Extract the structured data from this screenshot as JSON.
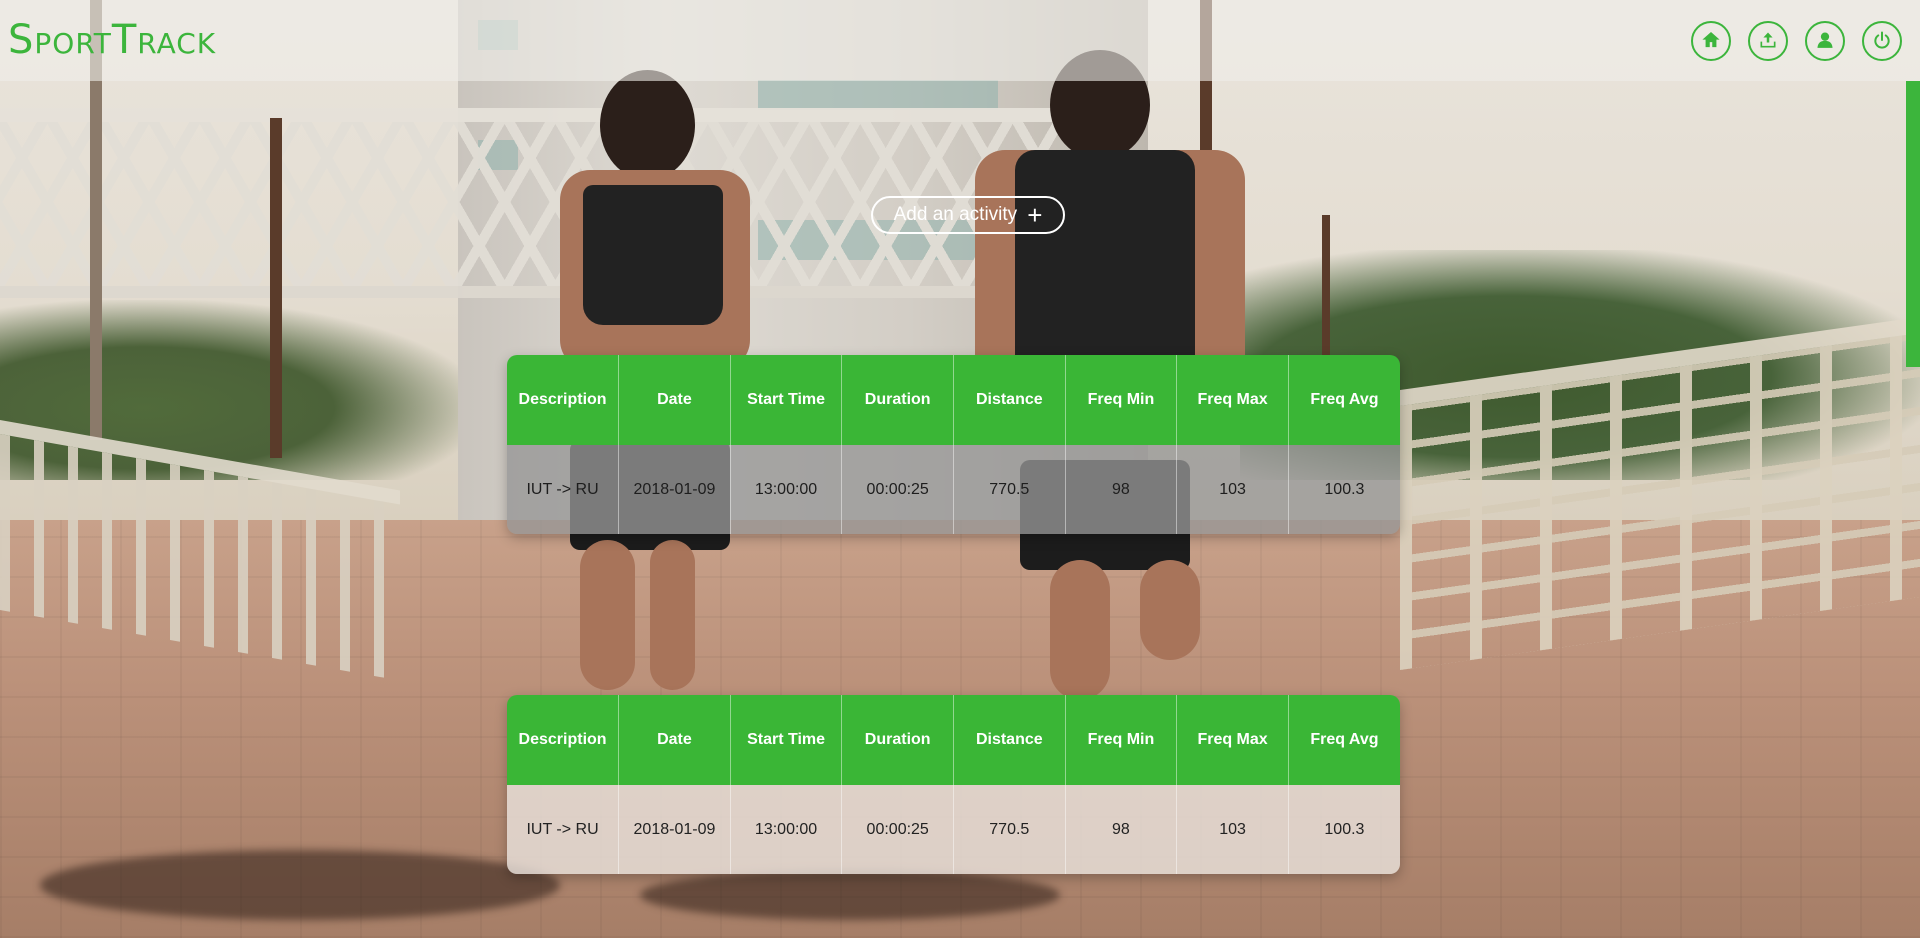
{
  "app": {
    "logo": "SportTrack"
  },
  "nav": {
    "items": [
      {
        "name": "home",
        "icon": "home-icon"
      },
      {
        "name": "upload",
        "icon": "upload-icon"
      },
      {
        "name": "profile",
        "icon": "user-icon"
      },
      {
        "name": "logout",
        "icon": "power-icon"
      }
    ]
  },
  "main": {
    "add_activity_label": "Add an activity",
    "add_activity_icon": "+"
  },
  "table": {
    "headers": [
      "Description",
      "Date",
      "Start Time",
      "Duration",
      "Distance",
      "Freq Min",
      "Freq Max",
      "Freq Avg"
    ]
  },
  "activities": [
    {
      "description": "IUT -> RU",
      "date": "2018-01-09",
      "start_time": "13:00:00",
      "duration": "00:00:25",
      "distance": "770.5",
      "freq_min": "98",
      "freq_max": "103",
      "freq_avg": "100.3"
    },
    {
      "description": "IUT -> RU",
      "date": "2018-01-09",
      "start_time": "13:00:00",
      "duration": "00:00:25",
      "distance": "770.5",
      "freq_min": "98",
      "freq_max": "103",
      "freq_avg": "100.3"
    }
  ],
  "colors": {
    "accent": "#3cb53c",
    "header_cell": "#3ab636",
    "text": "#222222"
  }
}
